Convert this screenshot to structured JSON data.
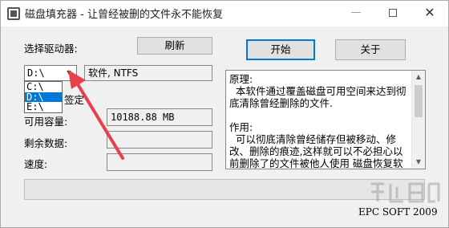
{
  "window": {
    "title": "磁盘填充器 - 让曾经被删的文件永不能恢复",
    "minimize_glyph": "—",
    "close_glyph": "✕"
  },
  "drive": {
    "label": "选择驱动器:",
    "refresh_label": "刷新",
    "selected": "D:\\",
    "options": [
      "C:\\",
      "D:\\",
      "E:\\"
    ],
    "info": "软件, NTFS",
    "partial_label": "签定"
  },
  "actions": {
    "start_label": "开始",
    "about_label": "关于"
  },
  "stats": {
    "available_label": "可用容量:",
    "available_value": "10188.88 MB",
    "remaining_label": "剩余数据:",
    "remaining_value": "",
    "speed_label": "速度:",
    "speed_value": ""
  },
  "description": "原理:\n  本软件通过覆盖磁盘可用空间来达到彻底清除曾经删除的文件.\n\n作用:\n  可以彻底清除曾经储存但被移动、修改、删除的痕迹,这样就可以不必担心以前删除了的文件被他人使用 磁盘恢复软件 恢复了.",
  "progress": {
    "value": 0
  },
  "footer": "EPC SOFT 2009",
  "colors": {
    "accent": "#0078d7",
    "annotation_arrow": "#e8404a"
  }
}
